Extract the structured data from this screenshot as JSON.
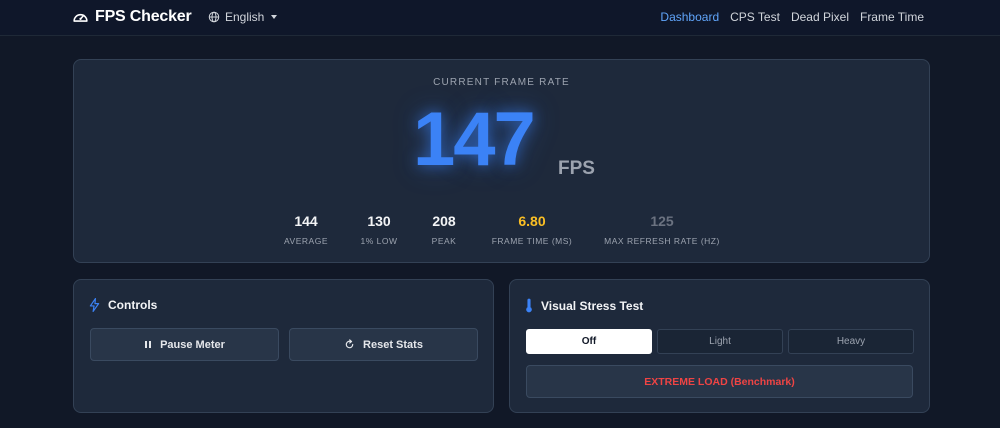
{
  "nav": {
    "brand": "FPS Checker",
    "language": "English",
    "links": [
      "Dashboard",
      "CPS Test",
      "Dead Pixel",
      "Frame Time"
    ],
    "active_link": "Dashboard"
  },
  "hero": {
    "caption": "CURRENT FRAME RATE",
    "fps": "147",
    "unit": "FPS",
    "stats": [
      {
        "value": "144",
        "label": "AVERAGE"
      },
      {
        "value": "130",
        "label": "1% LOW"
      },
      {
        "value": "208",
        "label": "PEAK"
      },
      {
        "value": "6.80",
        "label": "FRAME TIME (MS)"
      },
      {
        "value": "125",
        "label": "MAX REFRESH RATE (HZ)"
      }
    ]
  },
  "controls": {
    "title": "Controls",
    "pause_label": "Pause Meter",
    "reset_label": "Reset Stats"
  },
  "stress": {
    "title": "Visual Stress Test",
    "options": [
      "Off",
      "Light",
      "Heavy"
    ],
    "selected": "Off",
    "extreme_label": "EXTREME LOAD (Benchmark)"
  },
  "colors": {
    "accent": "#3b82f6",
    "warning": "#fbbf24",
    "danger": "#ef4444"
  }
}
